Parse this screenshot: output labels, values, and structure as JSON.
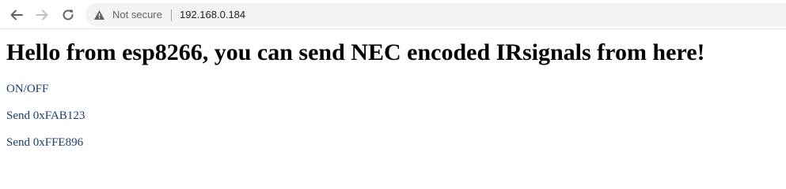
{
  "browser": {
    "security_label": "Not secure",
    "url": "192.168.0.184"
  },
  "page": {
    "heading": "Hello from esp8266, you can send NEC encoded IRsignals from here!",
    "links": [
      {
        "label": "ON/OFF"
      },
      {
        "label": "Send 0xFAB123"
      },
      {
        "label": "Send 0xFFE896"
      }
    ]
  },
  "colors": {
    "link": "#1a3d6b",
    "omnibox_bg": "#f1f3f4"
  }
}
